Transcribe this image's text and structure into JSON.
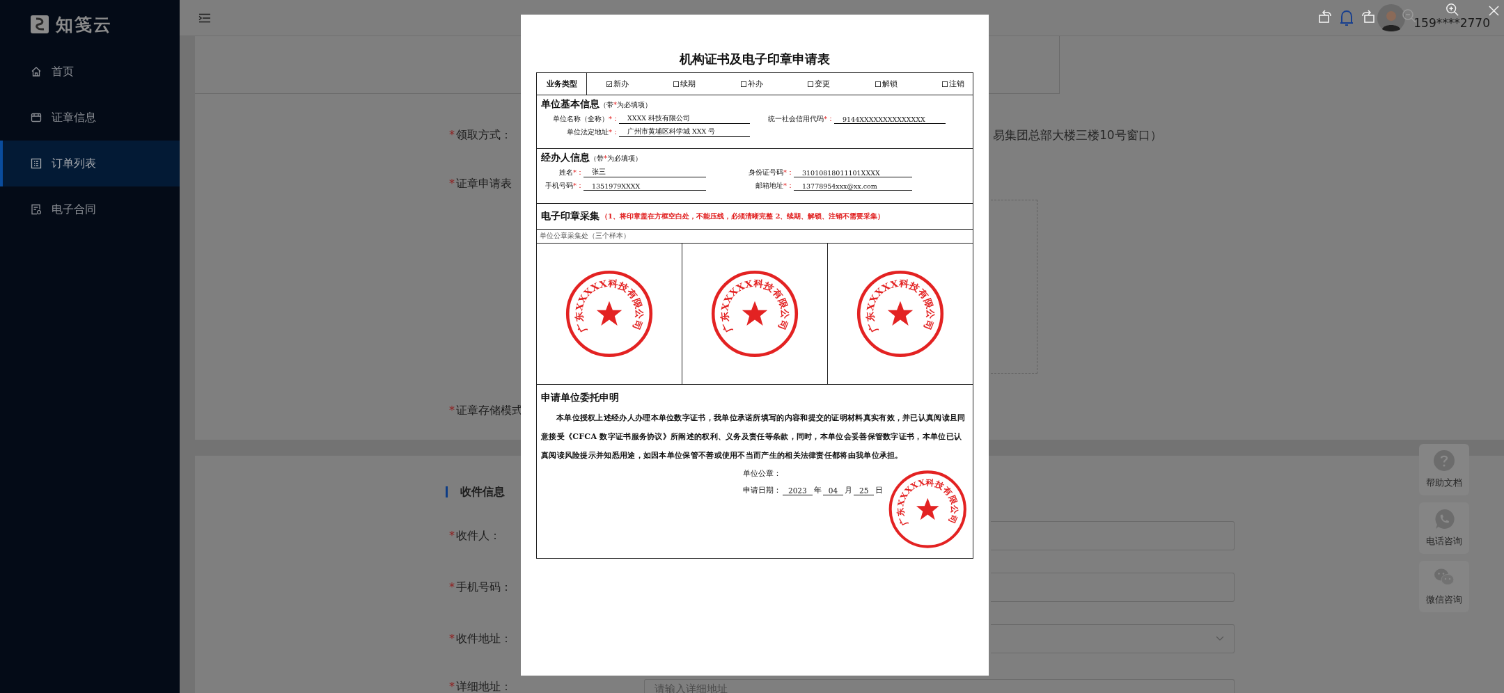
{
  "sidebar": {
    "logo": "知笺云",
    "items": [
      {
        "label": "首页",
        "selected": false
      },
      {
        "label": "证章信息",
        "selected": false
      },
      {
        "label": "订单列表",
        "selected": true
      },
      {
        "label": "电子合同",
        "selected": false
      }
    ]
  },
  "header": {
    "user": "159****2770"
  },
  "form": {
    "pickup": {
      "mark": "*",
      "label": "领取方式：",
      "value": "易集团总部大楼三楼10号窗口）"
    },
    "scan": {
      "mark": "*",
      "label": "证章申请表"
    },
    "storage": {
      "mark": "*",
      "label": "证章存储模式"
    }
  },
  "recipient": {
    "title": "收件信息",
    "fields": [
      {
        "mark": "*",
        "label": "收件人：",
        "kind": "input"
      },
      {
        "mark": "*",
        "label": "手机号码：",
        "kind": "input"
      },
      {
        "mark": "*",
        "label": "收件地址：",
        "kind": "select"
      },
      {
        "mark": "*",
        "label": "详细地址：",
        "kind": "input",
        "placeholder": "请输入详细地址"
      }
    ]
  },
  "help_buttons": [
    {
      "label": "帮助文档"
    },
    {
      "label": "电话咨询"
    },
    {
      "label": "微信咨询"
    }
  ],
  "document": {
    "title": "机构证书及电子印章申请表",
    "business": {
      "label": "业务类型",
      "options": [
        {
          "label": "新办",
          "checked": true
        },
        {
          "label": "续期",
          "checked": false
        },
        {
          "label": "补办",
          "checked": false
        },
        {
          "label": "变更",
          "checked": false
        },
        {
          "label": "解锁",
          "checked": false
        },
        {
          "label": "注销",
          "checked": false
        }
      ]
    },
    "unit": {
      "heading": "单位基本信息",
      "note": [
        "（带",
        "*",
        "为必填项）"
      ],
      "fields": [
        {
          "label": "单位名称（全称）",
          "mark": "*：",
          "value": "XXXX 科技有限公司"
        },
        {
          "label": "统一社会信用代码",
          "mark": "*：",
          "value": "9144XXXXXXXXXXXXXX"
        },
        {
          "label": "单位法定地址",
          "mark": "*：",
          "value": "广州市黄埔区科学城 XXX 号"
        }
      ]
    },
    "agent": {
      "heading": "经办人信息",
      "note": [
        "（带",
        "*",
        "为必填项）"
      ],
      "fields": [
        {
          "label": "姓名",
          "mark": "*：",
          "value": "张三"
        },
        {
          "label": "身份证号码",
          "mark": "*：",
          "value": "31010818011101XXXX"
        },
        {
          "label": "手机号码",
          "mark": "*：",
          "value": "1351979XXXX"
        },
        {
          "label": "邮箱地址",
          "mark": "*：",
          "value": "13778954xxx@xx.com"
        }
      ]
    },
    "seal": {
      "heading": "电子印章采集",
      "note": "（1、将印章盖在方框空白处，不能压线，必须清晰完整 2、续期、解锁、注销不需要采集）",
      "area_label": "单位公章采集处（三个样本）",
      "stamps": [
        "广东XXXXX科技有限公司",
        "广东XXXXX科技有限公司",
        "广东XXXXX科技有限公司"
      ]
    },
    "statement": {
      "heading": "申请单位委托申明",
      "text": "本单位授权上述经办人办理本单位数字证书，我单位承诺所填写的内容和提交的证明材料真实有效，并已认真阅读且同意接受《CFCA 数字证书服务协议》所阐述的权利、义务及责任等条款，同时，本单位会妥善保管数字证书，本单位已认真阅读风险提示并知悉用途，如因本单位保管不善或使用不当而产生的相关法律责任都将由我单位承担。",
      "seal_label": "单位公章：",
      "date_label": "申请日期：",
      "date": [
        {
          "value": "2023",
          "unit": "年"
        },
        {
          "value": "04",
          "unit": "月"
        },
        {
          "value": "25",
          "unit": "日"
        }
      ],
      "stamp": "广东XXXXX科技有限公司"
    }
  }
}
